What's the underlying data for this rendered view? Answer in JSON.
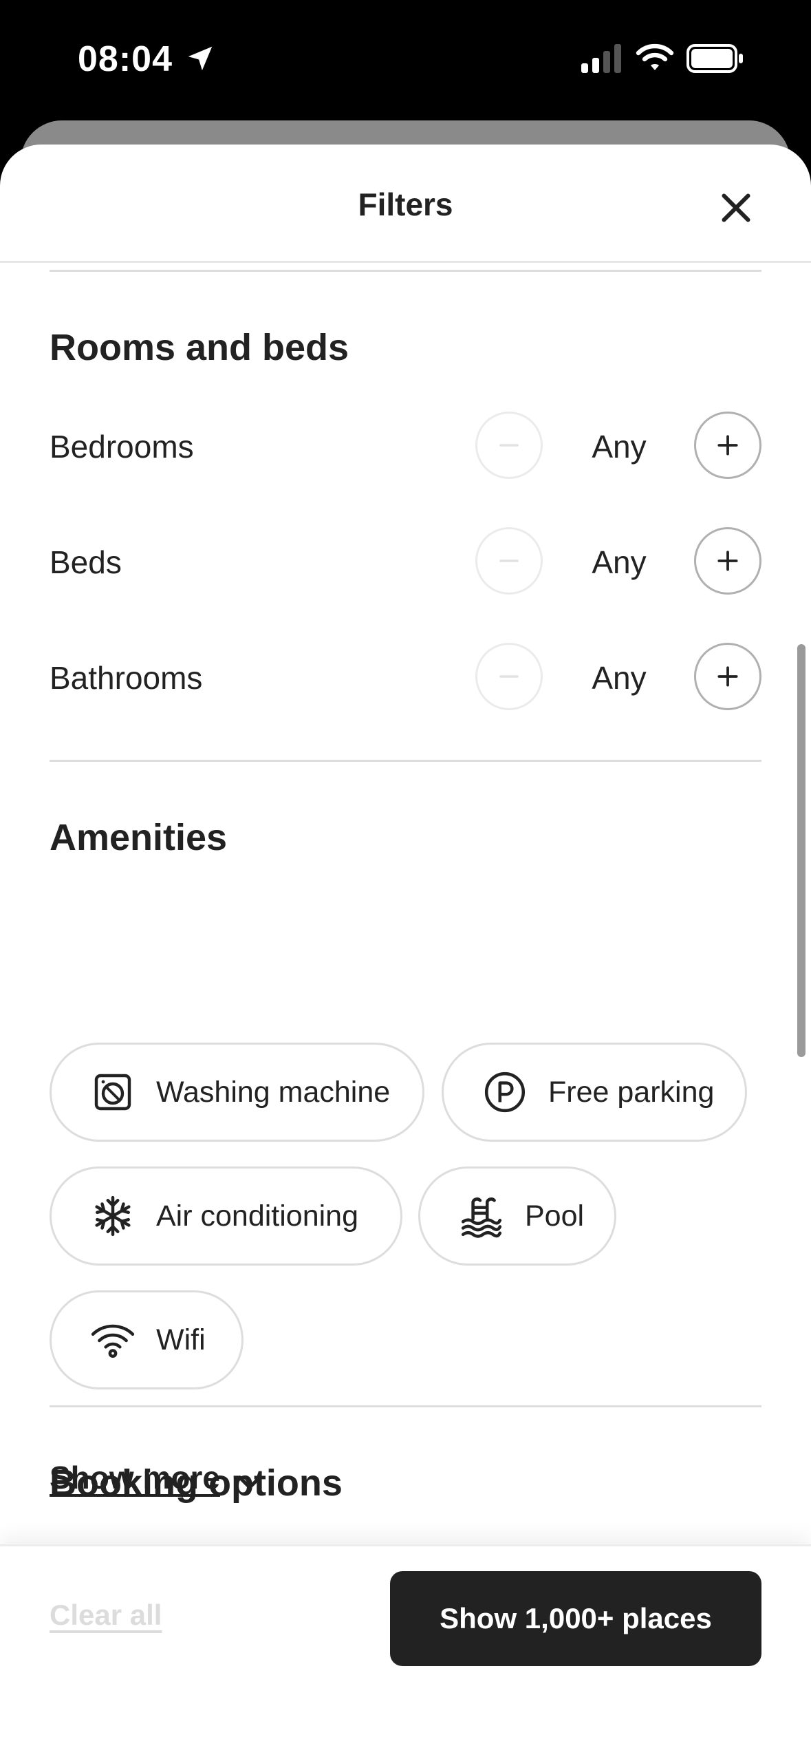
{
  "status_bar": {
    "time": "08:04"
  },
  "sheet": {
    "title": "Filters"
  },
  "rooms": {
    "title": "Rooms and beds",
    "rows": [
      {
        "label": "Bedrooms",
        "value": "Any"
      },
      {
        "label": "Beds",
        "value": "Any"
      },
      {
        "label": "Bathrooms",
        "value": "Any"
      }
    ]
  },
  "amenities": {
    "title": "Amenities",
    "items": [
      {
        "label": "Washing machine",
        "icon": "washing-machine-icon"
      },
      {
        "label": "Free parking",
        "icon": "parking-icon"
      },
      {
        "label": "Air conditioning",
        "icon": "snowflake-icon"
      },
      {
        "label": "Pool",
        "icon": "pool-icon"
      },
      {
        "label": "Wifi",
        "icon": "wifi-icon"
      }
    ],
    "show_more": "Show more"
  },
  "booking": {
    "title": "Booking options"
  },
  "footer": {
    "clear_all": "Clear all",
    "show_button": "Show 1,000+ places"
  }
}
